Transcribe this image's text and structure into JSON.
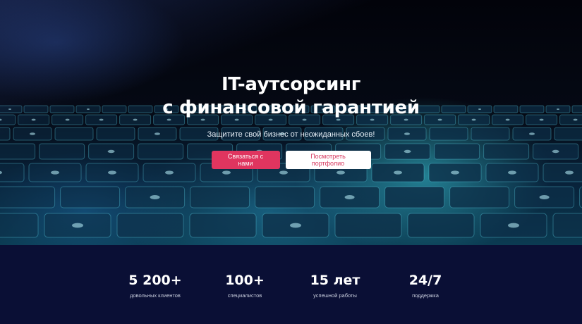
{
  "hero": {
    "title_line1": "IT-аутсорсинг",
    "title_line2": "с финансовой гарантией",
    "subtitle": "Защитите свой бизнес от неожиданных сбоев!",
    "contact_button": "Связаться с нами",
    "portfolio_button": "Посмотреть портфолио"
  },
  "stats": [
    {
      "value": "5 200+",
      "label": "довольных клиентов"
    },
    {
      "value": "100+",
      "label": "специалистов"
    },
    {
      "value": "15 лет",
      "label": "успешной работы"
    },
    {
      "value": "24/7",
      "label": "поддержка"
    }
  ],
  "colors": {
    "accent": "#e0355f",
    "stats_background": "#0a0f35",
    "hero_glow": "#3ad0e0"
  }
}
